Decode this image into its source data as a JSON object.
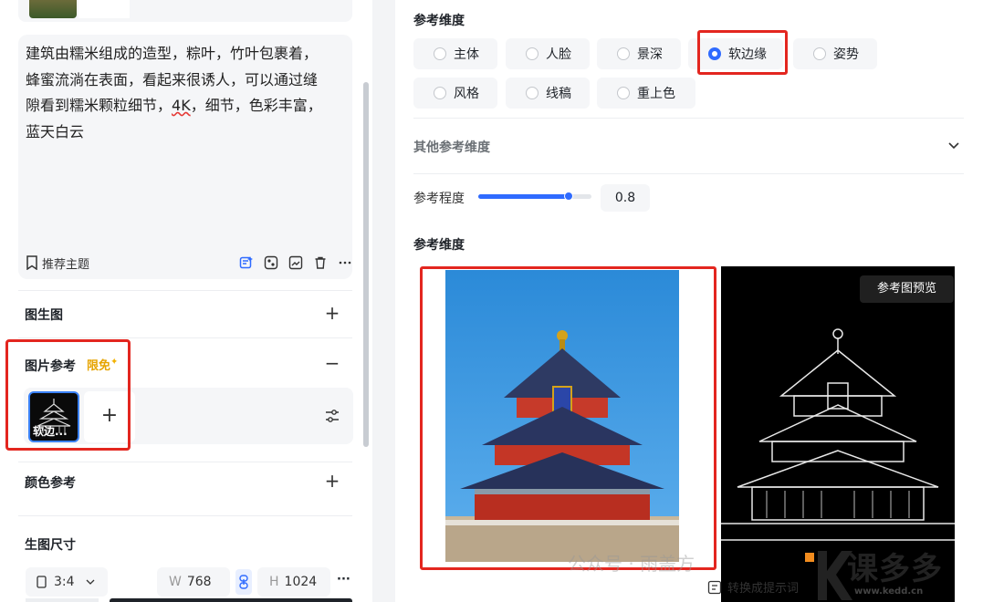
{
  "prompt": {
    "line1": "建筑由糯米组成的造型，粽叶，竹叶包裹着，",
    "line2": "蜂蜜流淌在表面，看起来很诱人，可以通过缝",
    "line3_a": "隙看到糯米颗粒细节，",
    "line3_u": "4K",
    "line3_b": "，细节，色彩丰富，",
    "line4": "蓝天白云",
    "recommend_label": "推荐主题"
  },
  "left_sections": {
    "img2img": "图生图",
    "image_ref": "图片参考",
    "free_tag": "限免",
    "free_star": "✦",
    "ref_thumb_label": "软边...",
    "color_ref": "颜色参考",
    "gen_size": "生图尺寸",
    "ratio": "3:4",
    "width_label": "W",
    "width_value": "768",
    "height_label": "H",
    "height_value": "1024",
    "more": "···"
  },
  "right_panel": {
    "dim_title": "参考维度",
    "options": [
      {
        "label": "主体",
        "selected": false
      },
      {
        "label": "人脸",
        "selected": false
      },
      {
        "label": "景深",
        "selected": false
      },
      {
        "label": "软边缘",
        "selected": true
      },
      {
        "label": "姿势",
        "selected": false
      },
      {
        "label": "风格",
        "selected": false
      },
      {
        "label": "线稿",
        "selected": false
      },
      {
        "label": "重上色",
        "selected": false
      }
    ],
    "other_dims": "其他参考维度",
    "strength_label": "参考程度",
    "strength_value": "0.8",
    "strength_fraction": 0.8,
    "preview_title": "参考维度",
    "preview_tag": "参考图预览",
    "convert_label": "转换成提示词",
    "watermark": "公众号 · 雨盖方",
    "logo_text": "课多多",
    "logo_url": "www.kedd.cn"
  },
  "colors": {
    "accent": "#2f6bff",
    "highlight_red": "#e3261f",
    "free_tag": "#e6a400"
  }
}
